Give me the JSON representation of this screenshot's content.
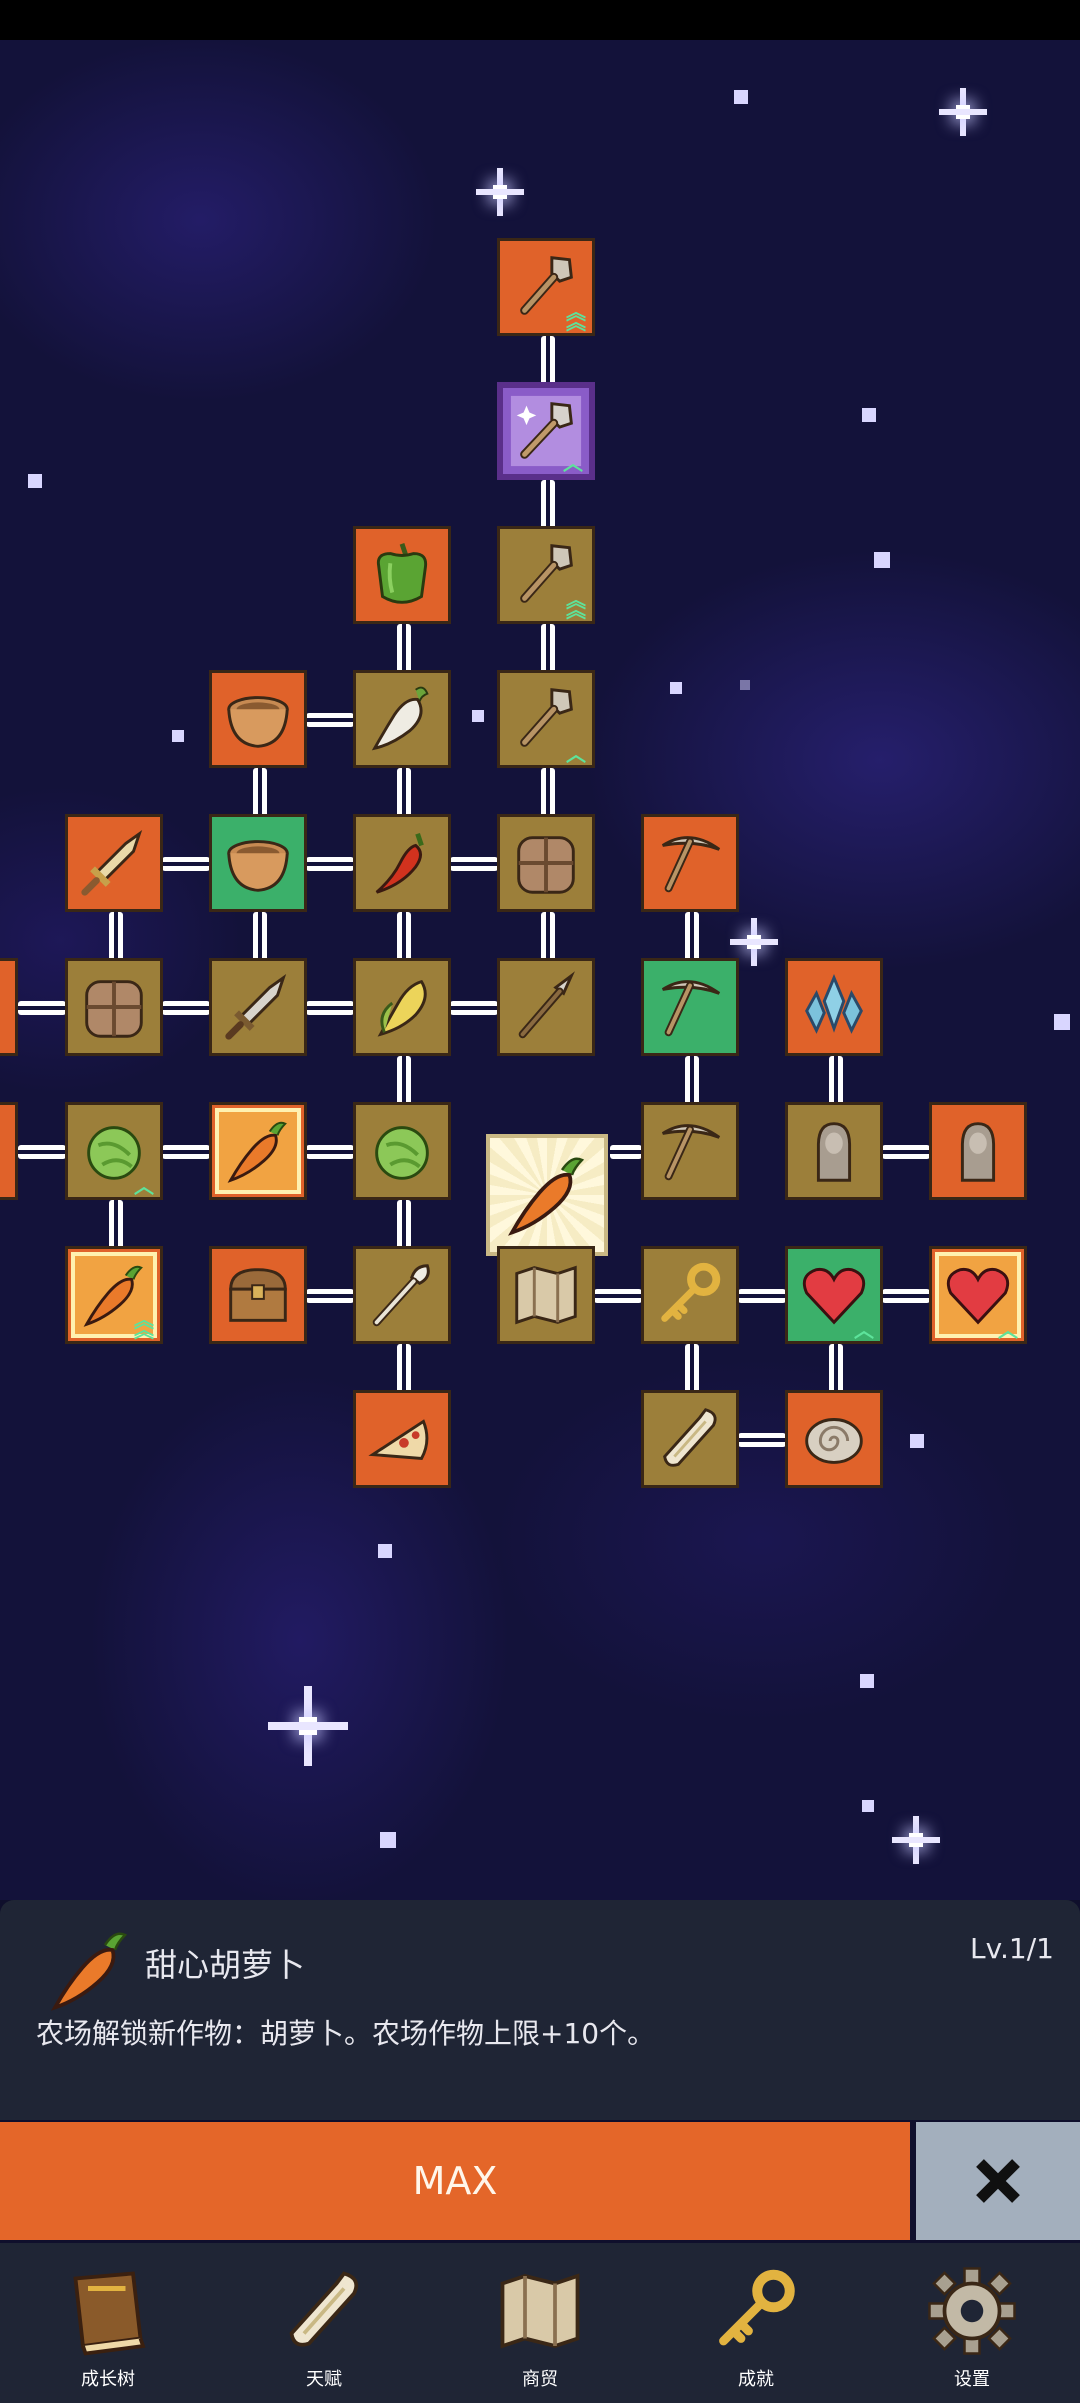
{
  "skill_tree": {
    "nodes": [
      {
        "id": "shovel-top",
        "icon": "shovel-icon",
        "color": "orange",
        "upgrade": "double"
      },
      {
        "id": "magic-shovel",
        "icon": "magic-shovel-icon",
        "color": "purple",
        "upgrade": "single"
      },
      {
        "id": "shovel-2",
        "icon": "shovel-icon",
        "color": "tan",
        "upgrade": "double"
      },
      {
        "id": "shovel-3",
        "icon": "shovel-icon",
        "color": "tan",
        "upgrade": "single"
      },
      {
        "id": "pepper",
        "icon": "bell-pepper-icon",
        "color": "orange"
      },
      {
        "id": "bowl-1",
        "icon": "bowl-icon",
        "color": "orange"
      },
      {
        "id": "radish",
        "icon": "radish-icon",
        "color": "tan"
      },
      {
        "id": "sword-1",
        "icon": "sword-icon",
        "color": "orange"
      },
      {
        "id": "bowl-2",
        "icon": "bowl-icon",
        "color": "green"
      },
      {
        "id": "chili",
        "icon": "chili-icon",
        "color": "tan"
      },
      {
        "id": "backpack-1",
        "icon": "backpack-icon",
        "color": "tan"
      },
      {
        "id": "pickaxe-1",
        "icon": "pickaxe-icon",
        "color": "orange"
      },
      {
        "id": "edge-left-1",
        "icon": "partial-icon",
        "color": "orange"
      },
      {
        "id": "backpack-2",
        "icon": "backpack-icon",
        "color": "tan"
      },
      {
        "id": "sword-2",
        "icon": "sword-icon",
        "color": "tan"
      },
      {
        "id": "corn",
        "icon": "corn-icon",
        "color": "tan"
      },
      {
        "id": "spear",
        "icon": "spear-icon",
        "color": "tan"
      },
      {
        "id": "pickaxe-2",
        "icon": "pickaxe-icon",
        "color": "green"
      },
      {
        "id": "crystal",
        "icon": "crystal-icon",
        "color": "orange"
      },
      {
        "id": "edge-left-2",
        "icon": "partial-icon",
        "color": "orange"
      },
      {
        "id": "cabbage-1",
        "icon": "cabbage-icon",
        "color": "tan",
        "upgrade": "single"
      },
      {
        "id": "carrot-1",
        "icon": "carrot-icon",
        "color": "orange",
        "inner": true
      },
      {
        "id": "cabbage-2",
        "icon": "cabbage-icon",
        "color": "tan"
      },
      {
        "id": "carrot-selected",
        "icon": "carrot-icon",
        "color": "selected"
      },
      {
        "id": "pickaxe-3",
        "icon": "pickaxe-icon",
        "color": "tan"
      },
      {
        "id": "statue-1",
        "icon": "statue-icon",
        "color": "tan"
      },
      {
        "id": "statue-2",
        "icon": "statue-icon",
        "color": "orange"
      },
      {
        "id": "carrot-2",
        "icon": "carrot-icon",
        "color": "orange",
        "inner": true,
        "upgrade": "double"
      },
      {
        "id": "chest",
        "icon": "treasure-chest-icon",
        "color": "orange"
      },
      {
        "id": "torch",
        "icon": "torch-icon",
        "color": "tan"
      },
      {
        "id": "map",
        "icon": "map-icon",
        "color": "tan"
      },
      {
        "id": "key",
        "icon": "key-icon",
        "color": "tan"
      },
      {
        "id": "heart-1",
        "icon": "heart-icon",
        "color": "green",
        "upgrade": "single"
      },
      {
        "id": "heart-2",
        "icon": "heart-icon",
        "color": "orange",
        "inner": true,
        "upgrade": "single"
      },
      {
        "id": "pizza",
        "icon": "pizza-icon",
        "color": "orange"
      },
      {
        "id": "scroll",
        "icon": "scroll-icon",
        "color": "tan"
      },
      {
        "id": "fossil",
        "icon": "fossil-icon",
        "color": "orange"
      }
    ]
  },
  "detail": {
    "icon": "carrot-icon",
    "title": "甜心胡萝卜",
    "level": "Lv.1/1",
    "description": "农场解锁新作物：胡萝卜。农场作物上限+10个。"
  },
  "actions": {
    "max_label": "MAX",
    "close_icon": "close-icon"
  },
  "nav": [
    {
      "label": "成长树",
      "icon": "book-icon"
    },
    {
      "label": "天赋",
      "icon": "scroll-icon"
    },
    {
      "label": "商贸",
      "icon": "map-icon"
    },
    {
      "label": "成就",
      "icon": "key-icon"
    },
    {
      "label": "设置",
      "icon": "gear-icon"
    }
  ],
  "colors": {
    "node_orange": "#e0622a",
    "node_tan": "#9c7f3a",
    "node_green": "#3bb06a",
    "node_purple": "#8a5cc8",
    "button_orange": "#e46629",
    "close_gray": "#a3afbd",
    "panel": "#1f2535"
  }
}
